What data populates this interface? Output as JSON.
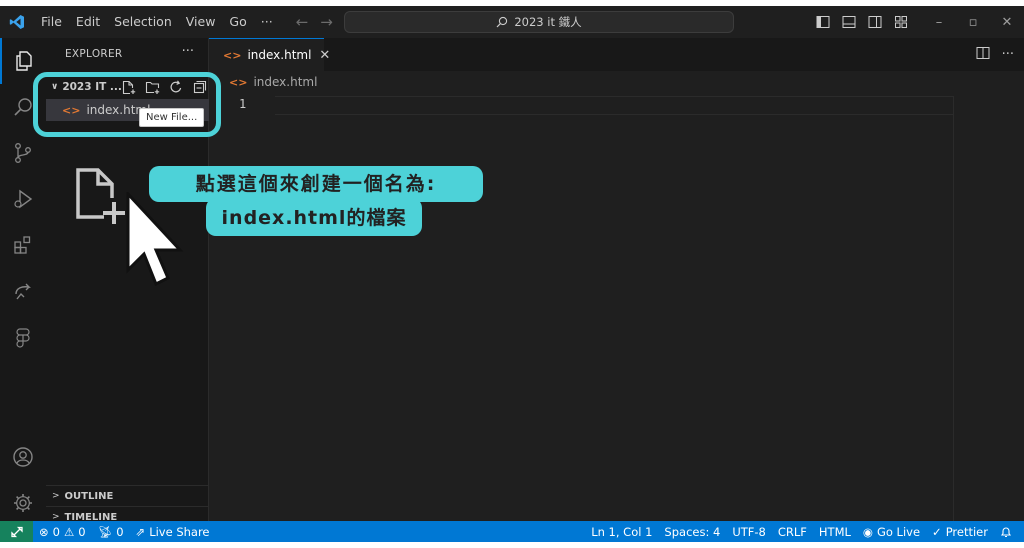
{
  "titlebar": {
    "menu": [
      "File",
      "Edit",
      "Selection",
      "View",
      "Go"
    ],
    "more": "···",
    "command_center": "2023 it 鐵人"
  },
  "sidebar": {
    "title": "EXPLORER",
    "more": "···",
    "folder": "2023 IT ...",
    "file": "index.html",
    "tooltip": "New File...",
    "outline": "OUTLINE",
    "timeline": "TIMELINE"
  },
  "editor": {
    "tab_label": "index.html",
    "breadcrumb": "index.html",
    "line_number": "1"
  },
  "annotation": {
    "line1": "點選這個來創建一個名為:",
    "line2": "index.html的檔案",
    "color": "#4dd2d8"
  },
  "statusbar": {
    "errors": "0",
    "warnings": "0",
    "ports": "0",
    "live_share": "Live Share",
    "position": "Ln 1, Col 1",
    "spaces": "Spaces: 4",
    "encoding": "UTF-8",
    "eol": "CRLF",
    "language": "HTML",
    "go_live": "Go Live",
    "prettier": "Prettier"
  },
  "icons": [
    "vscode-logo-icon",
    "search-icon",
    "layout-sidebar-icon",
    "explorer-icon",
    "source-control-icon",
    "run-debug-icon",
    "extensions-icon",
    "remote-explorer-icon",
    "figma-icon",
    "account-icon",
    "gear-icon",
    "new-file-icon",
    "new-folder-icon",
    "refresh-icon",
    "collapse-all-icon",
    "html-file-icon",
    "split-editor-icon",
    "cursor-arrow-icon",
    "remote-icon",
    "bell-icon"
  ],
  "colors": {
    "accent": "#0078d4",
    "remote": "#16825d",
    "html": "#e37933"
  }
}
